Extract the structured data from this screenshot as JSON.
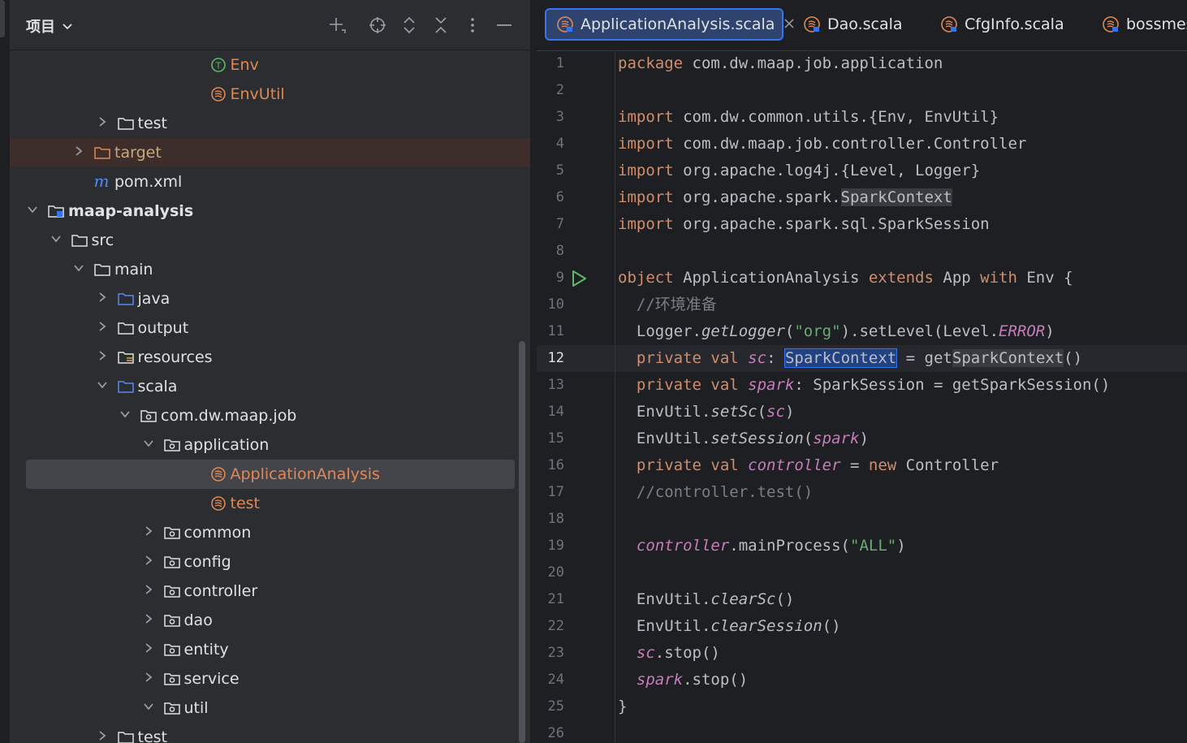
{
  "project": {
    "title": "项目",
    "toolbar_icons": [
      "add-icon",
      "locate-icon",
      "expand-all-icon",
      "collapse-all-icon",
      "more-options-icon",
      "minimize-icon"
    ],
    "tree": [
      {
        "label": "Env",
        "icon": "scala-trait-icon",
        "color": "orange",
        "depth": 9,
        "expand": "none"
      },
      {
        "label": "EnvUtil",
        "icon": "scala-object-icon",
        "color": "orange",
        "depth": 9,
        "expand": "none"
      },
      {
        "label": "test",
        "icon": "folder-icon",
        "depth": 5,
        "expand": "collapsed"
      },
      {
        "label": "target",
        "icon": "folder-orange-icon",
        "color": "dim",
        "depth": 4,
        "expand": "collapsed",
        "highlight": "target"
      },
      {
        "label": "pom.xml",
        "icon": "maven-icon",
        "depth": 4,
        "expand": "none"
      },
      {
        "label": "maap-analysis",
        "icon": "module-icon",
        "bold": true,
        "depth": 2,
        "expand": "expanded"
      },
      {
        "label": "src",
        "icon": "folder-icon",
        "depth": 3,
        "expand": "expanded"
      },
      {
        "label": "main",
        "icon": "folder-icon",
        "depth": 4,
        "expand": "expanded"
      },
      {
        "label": "java",
        "icon": "source-folder-icon",
        "depth": 5,
        "expand": "collapsed"
      },
      {
        "label": "output",
        "icon": "folder-icon",
        "depth": 5,
        "expand": "collapsed"
      },
      {
        "label": "resources",
        "icon": "resources-folder-icon",
        "depth": 5,
        "expand": "collapsed"
      },
      {
        "label": "scala",
        "icon": "source-folder-icon",
        "depth": 5,
        "expand": "expanded"
      },
      {
        "label": "com.dw.maap.job",
        "icon": "package-icon",
        "depth": 6,
        "expand": "expanded"
      },
      {
        "label": "application",
        "icon": "package-icon",
        "depth": 7,
        "expand": "expanded"
      },
      {
        "label": "ApplicationAnalysis",
        "icon": "scala-object-icon",
        "color": "orange",
        "depth": 9,
        "expand": "none",
        "selected": true
      },
      {
        "label": "test",
        "icon": "scala-object-icon",
        "color": "orange",
        "depth": 9,
        "expand": "none"
      },
      {
        "label": "common",
        "icon": "package-icon",
        "depth": 7,
        "expand": "collapsed"
      },
      {
        "label": "config",
        "icon": "package-icon",
        "depth": 7,
        "expand": "collapsed"
      },
      {
        "label": "controller",
        "icon": "package-icon",
        "depth": 7,
        "expand": "collapsed"
      },
      {
        "label": "dao",
        "icon": "package-icon",
        "depth": 7,
        "expand": "collapsed"
      },
      {
        "label": "entity",
        "icon": "package-icon",
        "depth": 7,
        "expand": "collapsed"
      },
      {
        "label": "service",
        "icon": "package-icon",
        "depth": 7,
        "expand": "collapsed"
      },
      {
        "label": "util",
        "icon": "package-icon",
        "depth": 7,
        "expand": "expanded"
      },
      {
        "label": "test",
        "icon": "folder-icon",
        "depth": 5,
        "expand": "collapsed"
      }
    ]
  },
  "editor": {
    "tabs": [
      {
        "label": "ApplicationAnalysis.scala",
        "active": true,
        "closable": true
      },
      {
        "label": "Dao.scala",
        "active": false
      },
      {
        "label": "CfgInfo.scala",
        "active": false
      },
      {
        "label": "bossmes",
        "active": false
      }
    ],
    "current_line": 12,
    "run_line": 9,
    "lines": [
      [
        [
          "kw",
          "package"
        ],
        [
          "t",
          " com.dw.maap.job.application"
        ]
      ],
      [],
      [
        [
          "kw",
          "import"
        ],
        [
          "t",
          " com.dw.common.utils.{Env, EnvUtil}"
        ]
      ],
      [
        [
          "kw",
          "import"
        ],
        [
          "t",
          " com.dw.maap.job.controller.Controller"
        ]
      ],
      [
        [
          "kw",
          "import"
        ],
        [
          "t",
          " org.apache.log4j.{Level, Logger}"
        ]
      ],
      [
        [
          "kw",
          "import"
        ],
        [
          "t",
          " org.apache.spark."
        ],
        [
          "hi",
          "SparkContext"
        ]
      ],
      [
        [
          "kw",
          "import"
        ],
        [
          "t",
          " org.apache.spark.sql.SparkSession"
        ]
      ],
      [],
      [
        [
          "kw",
          "object"
        ],
        [
          "t",
          " ApplicationAnalysis "
        ],
        [
          "kw",
          "extends"
        ],
        [
          "t",
          " App "
        ],
        [
          "kw",
          "with"
        ],
        [
          "t",
          " Env {"
        ]
      ],
      [
        [
          "t",
          "  "
        ],
        [
          "cm",
          "//环境准备"
        ]
      ],
      [
        [
          "t",
          "  Logger."
        ],
        [
          "it",
          "getLogger"
        ],
        [
          "t",
          "("
        ],
        [
          "st",
          "\"org\""
        ],
        [
          "t",
          ").setLevel(Level."
        ],
        [
          "fld",
          "ERROR"
        ],
        [
          "t",
          ")"
        ]
      ],
      [
        [
          "t",
          "  "
        ],
        [
          "kw",
          "private val "
        ],
        [
          "fld",
          "sc"
        ],
        [
          "t",
          ": "
        ],
        [
          "sel",
          "SparkContext"
        ],
        [
          "t",
          " = get"
        ],
        [
          "hi",
          "SparkContext"
        ],
        [
          "t",
          "()"
        ]
      ],
      [
        [
          "t",
          "  "
        ],
        [
          "kw",
          "private val "
        ],
        [
          "fld",
          "spark"
        ],
        [
          "t",
          ": SparkSession = getSparkSession()"
        ]
      ],
      [
        [
          "t",
          "  EnvUtil."
        ],
        [
          "it",
          "setSc"
        ],
        [
          "t",
          "("
        ],
        [
          "fld",
          "sc"
        ],
        [
          "t",
          ")"
        ]
      ],
      [
        [
          "t",
          "  EnvUtil."
        ],
        [
          "it",
          "setSession"
        ],
        [
          "t",
          "("
        ],
        [
          "fld",
          "spark"
        ],
        [
          "t",
          ")"
        ]
      ],
      [
        [
          "t",
          "  "
        ],
        [
          "kw",
          "private val "
        ],
        [
          "fld",
          "controller"
        ],
        [
          "t",
          " = "
        ],
        [
          "kw",
          "new"
        ],
        [
          "t",
          " Controller"
        ]
      ],
      [
        [
          "t",
          "  "
        ],
        [
          "cm",
          "//controller.test()"
        ]
      ],
      [],
      [
        [
          "t",
          "  "
        ],
        [
          "fld",
          "controller"
        ],
        [
          "t",
          ".mainProcess("
        ],
        [
          "st",
          "\"ALL\""
        ],
        [
          "t",
          ")"
        ]
      ],
      [],
      [
        [
          "t",
          "  EnvUtil."
        ],
        [
          "it",
          "clearSc"
        ],
        [
          "t",
          "()"
        ]
      ],
      [
        [
          "t",
          "  EnvUtil."
        ],
        [
          "it",
          "clearSession"
        ],
        [
          "t",
          "()"
        ]
      ],
      [
        [
          "t",
          "  "
        ],
        [
          "fld",
          "sc"
        ],
        [
          "t",
          ".stop()"
        ]
      ],
      [
        [
          "t",
          "  "
        ],
        [
          "fld",
          "spark"
        ],
        [
          "t",
          ".stop()"
        ]
      ],
      [
        [
          "t",
          "}"
        ]
      ],
      []
    ]
  }
}
